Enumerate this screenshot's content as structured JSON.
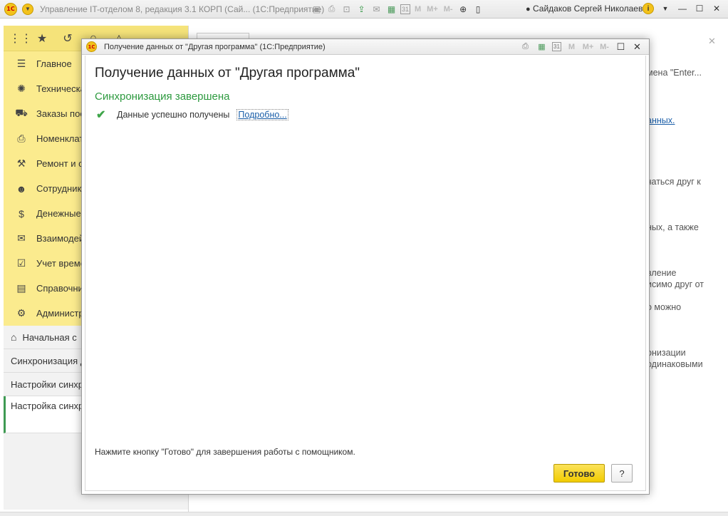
{
  "app": {
    "title": "Управление IT-отделом 8, редакция 3.1 КОРП (Сай...  (1С:Предприятие)",
    "logo_text": "1С",
    "user": "Сайдаков Сергей Николаевич",
    "memory_buttons": [
      "M",
      "M+",
      "M-"
    ],
    "calendar_day": "31"
  },
  "sidebar": {
    "sections": [
      {
        "label": "Главное",
        "icon": "menu-icon"
      },
      {
        "label": "Техническая",
        "icon": "support-icon"
      },
      {
        "label": "Заказы пос",
        "icon": "truck-icon"
      },
      {
        "label": "Номенклат",
        "icon": "printer-icon"
      },
      {
        "label": "Ремонт и с",
        "icon": "repair-icon"
      },
      {
        "label": "Сотрудник",
        "icon": "people-icon"
      },
      {
        "label": "Денежные",
        "icon": "money-bag-icon"
      },
      {
        "label": "Взаимодей",
        "icon": "envelope-icon"
      },
      {
        "label": "Учет време",
        "icon": "calendar-check-icon"
      },
      {
        "label": "Справочни",
        "icon": "books-icon"
      },
      {
        "label": "Администр",
        "icon": "gear-icon"
      }
    ],
    "nav": {
      "home": "Начальная с",
      "items": [
        "Синхронизация д",
        "Настройки синхр"
      ],
      "active": "Настройка синхр \"Другая програм"
    }
  },
  "background": {
    "lines": [
      "мена \"Enter...",
      "анных.",
      "чаться друг к",
      "ных, а также",
      "вление",
      "исимо друг от",
      "о можно",
      "онизации",
      "одинаковыми"
    ]
  },
  "dialog": {
    "title": "Получение данных от \"Другая программа\"  (1С:Предприятие)",
    "heading": "Получение данных от \"Другая программа\"",
    "status": "Синхронизация завершена",
    "result_text": "Данные успешно получены",
    "details_link": "Подробно...",
    "hint": "Нажмите кнопку \"Готово\" для завершения работы с помощником.",
    "done_button": "Готово",
    "help_button": "?"
  }
}
